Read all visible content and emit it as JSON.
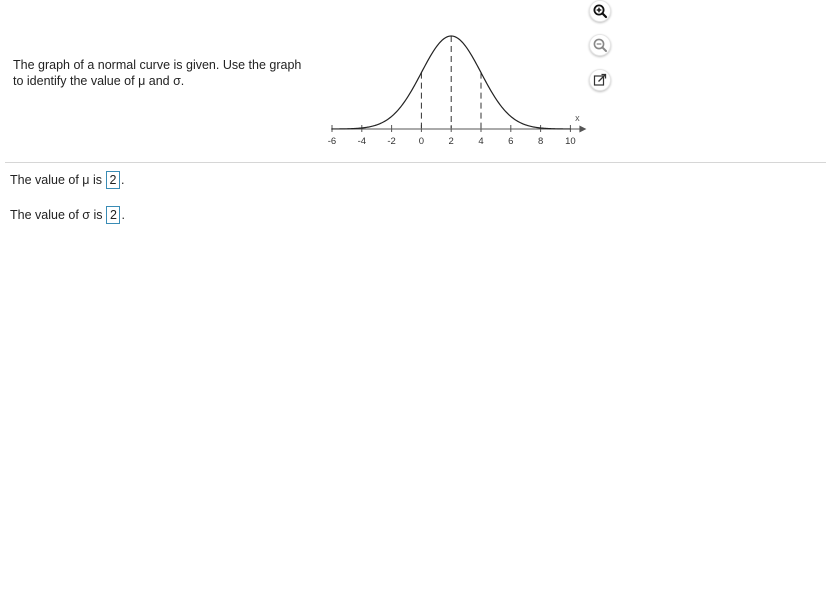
{
  "question": {
    "text": "The graph of a normal curve is given. Use the graph to identify the value of μ and σ."
  },
  "toolbar": {
    "zoom_in_icon": "zoom-in-icon",
    "zoom_out_icon": "zoom-out-icon",
    "popout_icon": "external-link-icon",
    "accent_color": "#3a8cb5"
  },
  "answers": {
    "mu": {
      "prefix": "The value of μ is",
      "value": "2",
      "suffix": "."
    },
    "sigma": {
      "prefix": "The value of σ is",
      "value": "2",
      "suffix": "."
    }
  },
  "chart_data": {
    "type": "line",
    "mean": 2,
    "std": 2,
    "xlim": [
      -6,
      10
    ],
    "x_ticks": [
      -6,
      -4,
      -2,
      0,
      2,
      4,
      6,
      8,
      10
    ],
    "x_tick_labels": [
      "-6",
      "-4",
      "-2",
      "0",
      "2",
      "4",
      "6",
      "8",
      "10"
    ],
    "xlabel": "x",
    "dashed_lines_x": [
      0,
      2,
      4
    ]
  }
}
